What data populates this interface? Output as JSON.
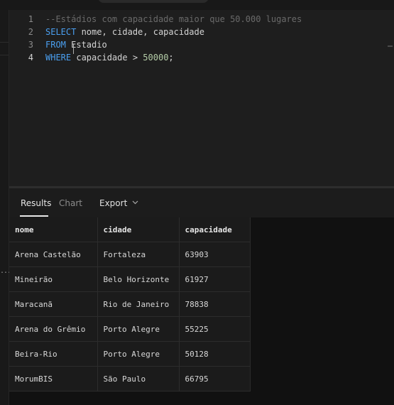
{
  "editor": {
    "lines": [
      {
        "number": "1",
        "comment": "--Estádios com capacidade maior que 50.000 lugares"
      },
      {
        "number": "2",
        "keyword": "SELECT",
        "rest": " nome, cidade, capacidade"
      },
      {
        "number": "3",
        "keyword": "FROM",
        "rest": " Estadio"
      },
      {
        "number": "4",
        "keyword": "WHERE",
        "rest": " capacidade ",
        "operator": ">",
        "space": " ",
        "number_literal": "50000",
        "tail": ";"
      }
    ]
  },
  "tabs": {
    "results_label": "Results",
    "chart_label": "Chart",
    "export_label": "Export"
  },
  "table": {
    "columns": [
      "nome",
      "cidade",
      "capacidade"
    ],
    "rows": [
      [
        "Arena Castelão",
        "Fortaleza",
        "63903"
      ],
      [
        "Mineirão",
        "Belo Horizonte",
        "61927"
      ],
      [
        "Maracanã",
        "Rio de Janeiro",
        "78838"
      ],
      [
        "Arena do Grêmio",
        "Porto Alegre",
        "55225"
      ],
      [
        "Beira-Rio",
        "Porto Alegre",
        "50128"
      ],
      [
        "MorumBIS",
        "São Paulo",
        "66795"
      ]
    ]
  },
  "sidebar": {
    "overflow_text": "..."
  },
  "icons": {
    "export_dropdown": "chevron-down-icon"
  },
  "colors": {
    "keyword": "#4a9ff0",
    "comment": "#6a6a6a",
    "number": "#b5cea8",
    "background": "#1c1c1c"
  }
}
